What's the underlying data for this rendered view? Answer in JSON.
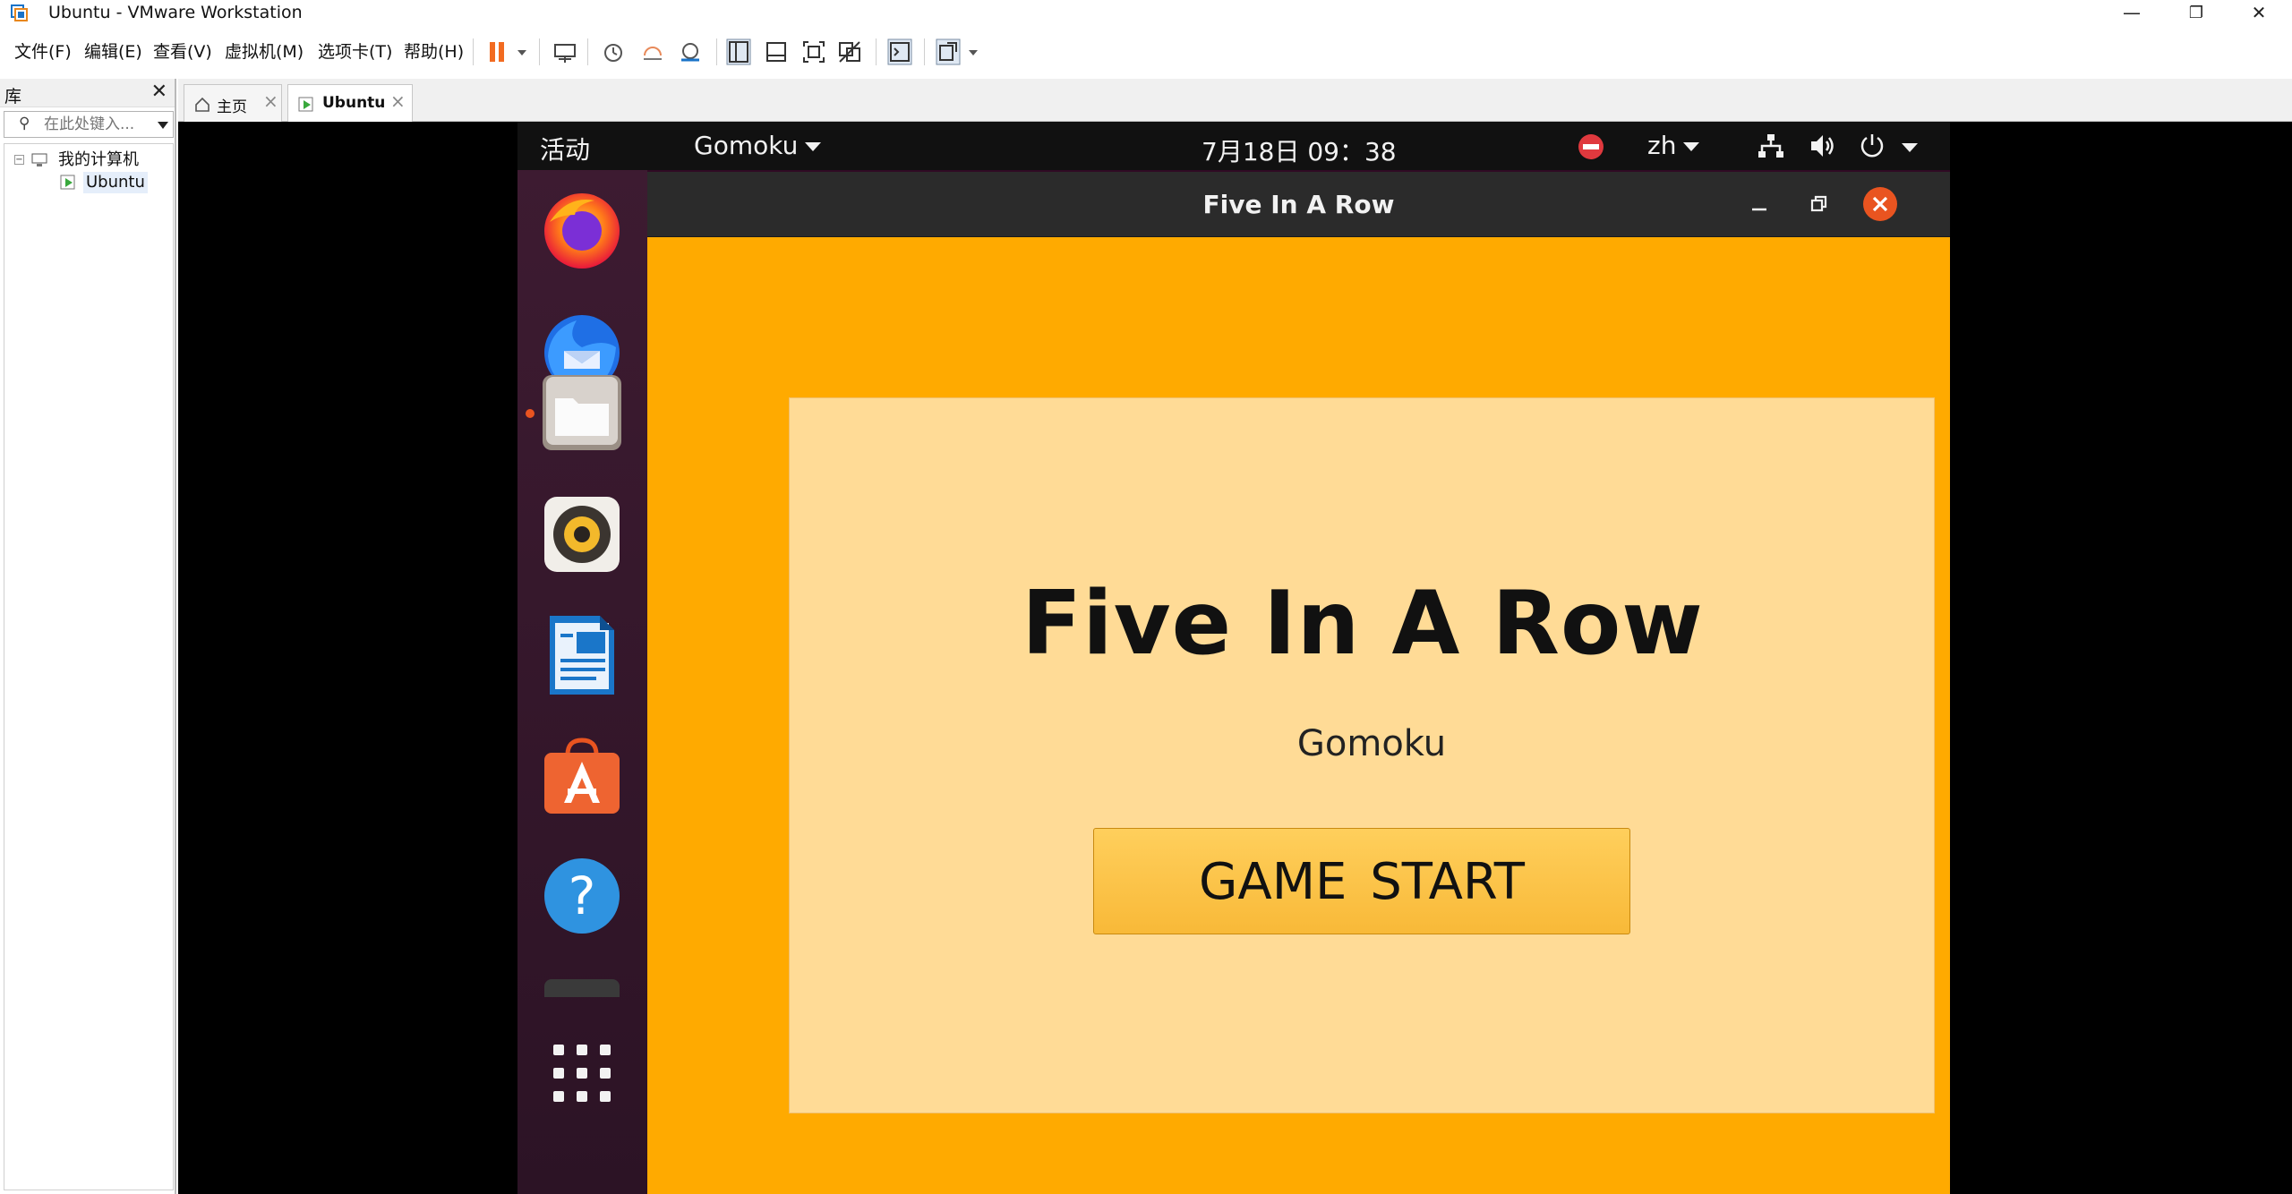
{
  "window": {
    "title": "Ubuntu  - VMware Workstation",
    "minimize_glyph": "—",
    "restore_glyph": "❐",
    "close_glyph": "✕"
  },
  "menu": {
    "items": [
      "文件(F)",
      "编辑(E)",
      "查看(V)",
      "虚拟机(M)",
      "选项卡(T)",
      "帮助(H)"
    ]
  },
  "toolbar": {
    "icons": [
      "pause-icon",
      "send-ctrl-alt-del-icon",
      "snapshot-icon",
      "revert-snapshot-icon",
      "snapshot-manager-icon",
      "show-library-icon",
      "thumbnail-bar-icon",
      "full-screen-icon",
      "unity-icon",
      "console-view-icon",
      "stretch-guest-icon"
    ]
  },
  "library": {
    "title": "库",
    "close_glyph": "✕",
    "search_placeholder": "在此处键入...",
    "tree": {
      "root_label": "我的计算机",
      "root_expander": "−",
      "child_label": "Ubuntu"
    }
  },
  "tabs": [
    {
      "label": "主页",
      "active": false
    },
    {
      "label": "Ubuntu",
      "active": true
    }
  ],
  "ubuntu": {
    "topbar": {
      "activities": "活动",
      "app_menu": "Gomoku",
      "clock": "7月18日  09：38",
      "language": "zh"
    },
    "dock": {
      "apps": [
        "firefox-icon",
        "thunderbird-icon",
        "files-icon",
        "rhythmbox-icon",
        "libreoffice-writer-icon",
        "ubuntu-software-icon",
        "help-icon",
        "terminal-icon",
        "show-applications-icon"
      ],
      "running_app": "files-icon"
    },
    "game_window": {
      "title": "Five In A Row",
      "heading": "Five In A Row",
      "subtitle": "Gomoku",
      "start_button": "GAME  START",
      "background_color": "#ffaa00",
      "panel_color": "#ffdb96"
    }
  }
}
